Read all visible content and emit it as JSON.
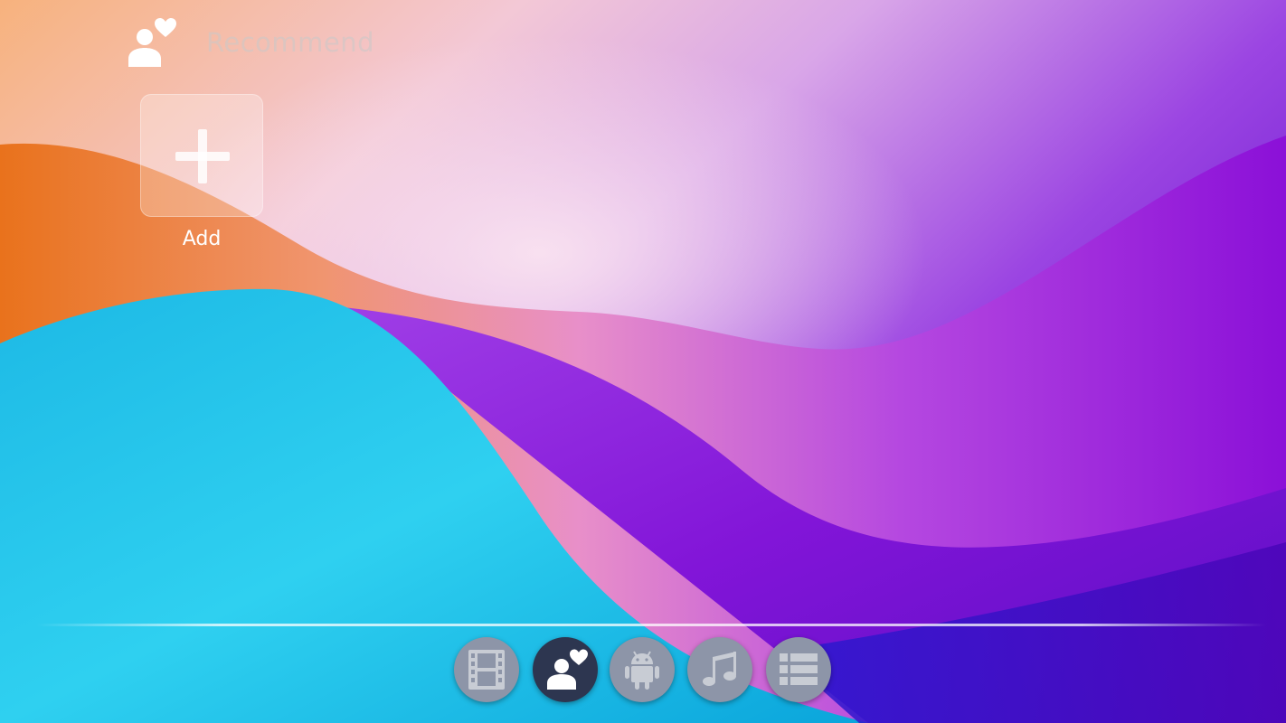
{
  "header": {
    "title": "Recommend",
    "icon": "user-heart-icon"
  },
  "tiles": [
    {
      "label": "Add",
      "icon": "plus-icon"
    }
  ],
  "dock": {
    "items": [
      {
        "name": "movies",
        "icon": "film-icon",
        "active": false
      },
      {
        "name": "recommend",
        "icon": "user-heart-icon",
        "active": true
      },
      {
        "name": "apps",
        "icon": "android-icon",
        "active": false
      },
      {
        "name": "music",
        "icon": "music-note-icon",
        "active": false
      },
      {
        "name": "list",
        "icon": "list-icon",
        "active": false
      }
    ]
  },
  "colors": {
    "dock_button": "#8d95a8",
    "dock_button_active": "#2d3650",
    "dock_icon": "#c8ccd4"
  }
}
